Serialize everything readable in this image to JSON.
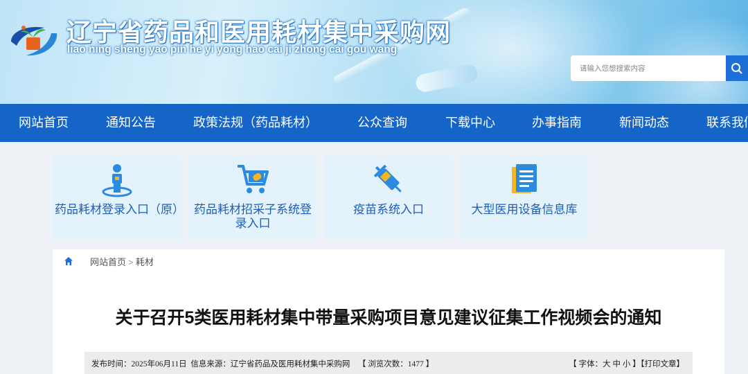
{
  "header": {
    "title": "辽宁省药品和医用耗材集中采购网",
    "pinyin": "liao ning sheng yao pin he yi yong hao cai ji zhong cai gou wang",
    "search_placeholder": "请输入您想搜索内容",
    "logo_icon": "plant-logo-icon",
    "search_icon": "search-icon"
  },
  "nav": [
    {
      "label": "网站首页"
    },
    {
      "label": "通知公告"
    },
    {
      "label": "政策法规（药品耗材）"
    },
    {
      "label": "公众查询"
    },
    {
      "label": "下载中心"
    },
    {
      "label": "办事指南"
    },
    {
      "label": "新闻动态"
    },
    {
      "label": "联系我们"
    }
  ],
  "cards": [
    {
      "label": "药品耗材登录入口（原）",
      "icon": "user-location-icon"
    },
    {
      "label": "药品耗材招采子系统登录入口",
      "icon": "cart-icon"
    },
    {
      "label": "疫苗系统入口",
      "icon": "syringe-icon"
    },
    {
      "label": "大型医用设备信息库",
      "icon": "document-icon"
    }
  ],
  "breadcrumb": {
    "text": "网站首页 > 耗材",
    "home_icon": "home-icon"
  },
  "article": {
    "title": "关于召开5类医用耗材集中带量采购项目意见建议征集工作视频会的通知",
    "meta_left": "发布时间：2025年06月11日  信息来源：辽宁省药品及医用耗材集中采购网    【 浏览次数：1477 】",
    "meta_right": "【 字体：大 中 小 】【打印文章】"
  },
  "colors": {
    "nav_bg": "#1565c8",
    "accent": "#1d5fb8",
    "card_bg": "#e4f2fb"
  }
}
